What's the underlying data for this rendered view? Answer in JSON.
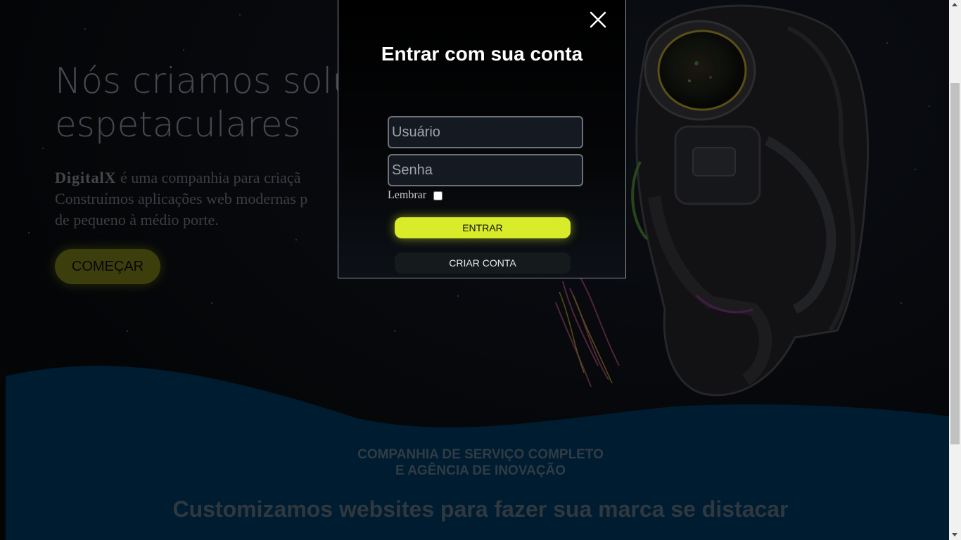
{
  "hero": {
    "title_line1": "Nós criamos solu",
    "title_line2": "espetaculares",
    "brand": "DigitalX",
    "text_line1": " é uma companhia para criaçã",
    "text_line2": "Construímos aplicações web modernas p",
    "text_line3": "de pequeno à médio porte.",
    "start_label": "COMEÇAR"
  },
  "section": {
    "subtitle_line1": "COMPANHIA DE SERVIÇO COMPLETO",
    "subtitle_line2": "E AGÊNCIA DE INOVAÇÃO",
    "title": "Customizamos websites para fazer sua marca se distacar"
  },
  "login_modal": {
    "title": "Entrar com sua conta",
    "username_placeholder": "Usuário",
    "password_placeholder": "Senha",
    "remember_label": "Lembrar",
    "enter_label": "ENTRAR",
    "create_label": "CRIAR CONTA"
  },
  "colors": {
    "accent": "#d8ec2a",
    "wave": "#002b4b",
    "background": "#07090c"
  }
}
